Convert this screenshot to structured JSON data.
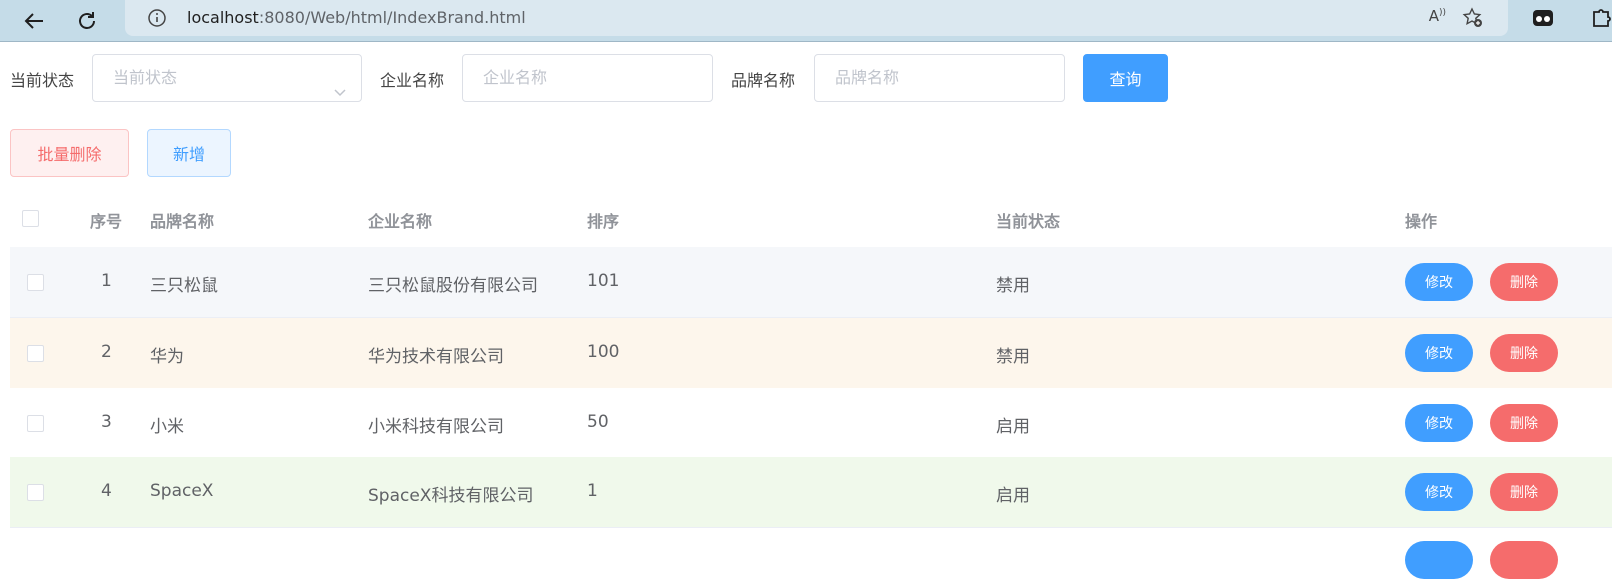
{
  "browser": {
    "url_host": "localhost",
    "url_rest": ":8080/Web/html/IndexBrand.html"
  },
  "search": {
    "status_label": "当前状态",
    "status_placeholder": "当前状态",
    "company_label": "企业名称",
    "company_placeholder": "企业名称",
    "brand_label": "品牌名称",
    "brand_placeholder": "品牌名称",
    "query_button": "查询"
  },
  "actions": {
    "batch_delete": "批量删除",
    "add": "新增"
  },
  "table": {
    "headers": {
      "index": "序号",
      "brand": "品牌名称",
      "company": "企业名称",
      "ordered": "排序",
      "status": "当前状态",
      "ops": "操作"
    },
    "edit_label": "修改",
    "delete_label": "删除",
    "rows": [
      {
        "index": "1",
        "brand": "三只松鼠",
        "company": "三只松鼠股份有限公司",
        "ordered": "101",
        "status": "禁用"
      },
      {
        "index": "2",
        "brand": "华为",
        "company": "华为技术有限公司",
        "ordered": "100",
        "status": "禁用"
      },
      {
        "index": "3",
        "brand": "小米",
        "company": "小米科技有限公司",
        "ordered": "50",
        "status": "启用"
      },
      {
        "index": "4",
        "brand": "SpaceX",
        "company": "SpaceX科技有限公司",
        "ordered": "1",
        "status": "启用"
      }
    ]
  },
  "colors": {
    "primary": "#409eff",
    "danger": "#f56c6c",
    "row_warning": "#fdf6ec",
    "row_success": "#f0f9eb"
  }
}
